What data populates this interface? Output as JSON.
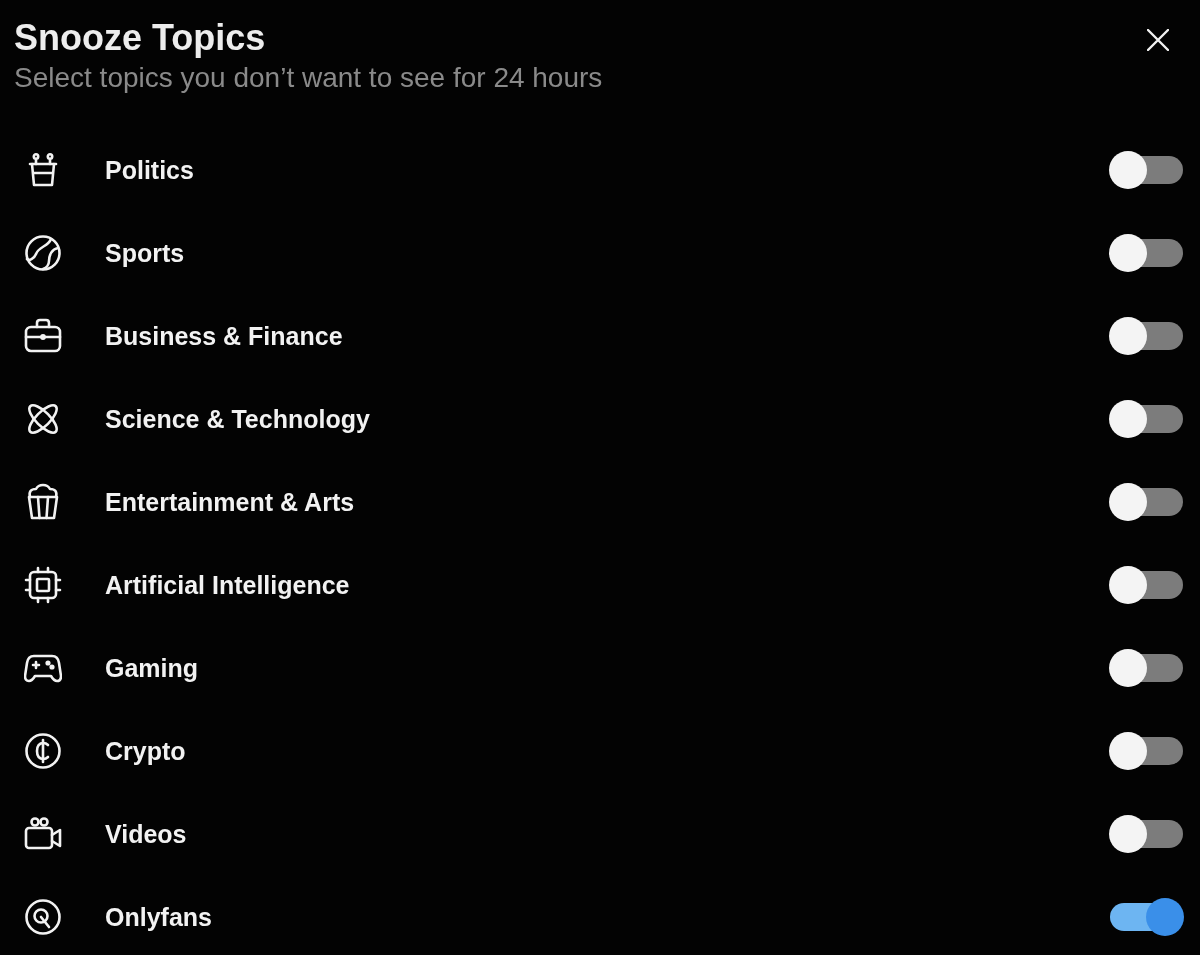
{
  "dialog": {
    "title": "Snooze Topics",
    "subtitle": "Select topics you don’t want to see for 24 hours"
  },
  "topics": [
    {
      "label": "Politics",
      "on": false
    },
    {
      "label": "Sports",
      "on": false
    },
    {
      "label": "Business & Finance",
      "on": false
    },
    {
      "label": "Science & Technology",
      "on": false
    },
    {
      "label": "Entertainment & Arts",
      "on": false
    },
    {
      "label": "Artificial Intelligence",
      "on": false
    },
    {
      "label": "Gaming",
      "on": false
    },
    {
      "label": "Crypto",
      "on": false
    },
    {
      "label": "Videos",
      "on": false
    },
    {
      "label": "Onlyfans",
      "on": true
    }
  ]
}
